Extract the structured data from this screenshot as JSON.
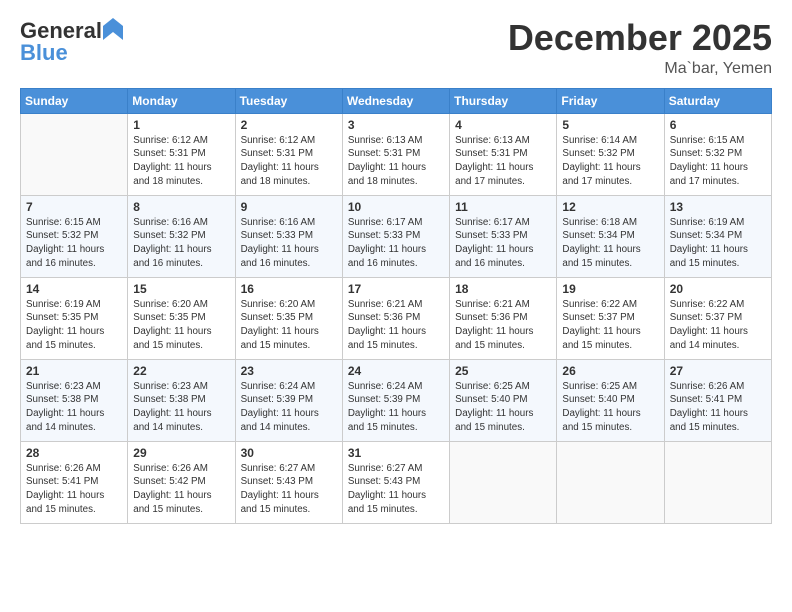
{
  "header": {
    "logo_line1": "General",
    "logo_line2": "Blue",
    "month": "December 2025",
    "location": "Ma`bar, Yemen"
  },
  "days_of_week": [
    "Sunday",
    "Monday",
    "Tuesday",
    "Wednesday",
    "Thursday",
    "Friday",
    "Saturday"
  ],
  "weeks": [
    [
      {
        "day": "",
        "info": ""
      },
      {
        "day": "1",
        "info": "Sunrise: 6:12 AM\nSunset: 5:31 PM\nDaylight: 11 hours\nand 18 minutes."
      },
      {
        "day": "2",
        "info": "Sunrise: 6:12 AM\nSunset: 5:31 PM\nDaylight: 11 hours\nand 18 minutes."
      },
      {
        "day": "3",
        "info": "Sunrise: 6:13 AM\nSunset: 5:31 PM\nDaylight: 11 hours\nand 18 minutes."
      },
      {
        "day": "4",
        "info": "Sunrise: 6:13 AM\nSunset: 5:31 PM\nDaylight: 11 hours\nand 17 minutes."
      },
      {
        "day": "5",
        "info": "Sunrise: 6:14 AM\nSunset: 5:32 PM\nDaylight: 11 hours\nand 17 minutes."
      },
      {
        "day": "6",
        "info": "Sunrise: 6:15 AM\nSunset: 5:32 PM\nDaylight: 11 hours\nand 17 minutes."
      }
    ],
    [
      {
        "day": "7",
        "info": "Sunrise: 6:15 AM\nSunset: 5:32 PM\nDaylight: 11 hours\nand 16 minutes."
      },
      {
        "day": "8",
        "info": "Sunrise: 6:16 AM\nSunset: 5:32 PM\nDaylight: 11 hours\nand 16 minutes."
      },
      {
        "day": "9",
        "info": "Sunrise: 6:16 AM\nSunset: 5:33 PM\nDaylight: 11 hours\nand 16 minutes."
      },
      {
        "day": "10",
        "info": "Sunrise: 6:17 AM\nSunset: 5:33 PM\nDaylight: 11 hours\nand 16 minutes."
      },
      {
        "day": "11",
        "info": "Sunrise: 6:17 AM\nSunset: 5:33 PM\nDaylight: 11 hours\nand 16 minutes."
      },
      {
        "day": "12",
        "info": "Sunrise: 6:18 AM\nSunset: 5:34 PM\nDaylight: 11 hours\nand 15 minutes."
      },
      {
        "day": "13",
        "info": "Sunrise: 6:19 AM\nSunset: 5:34 PM\nDaylight: 11 hours\nand 15 minutes."
      }
    ],
    [
      {
        "day": "14",
        "info": "Sunrise: 6:19 AM\nSunset: 5:35 PM\nDaylight: 11 hours\nand 15 minutes."
      },
      {
        "day": "15",
        "info": "Sunrise: 6:20 AM\nSunset: 5:35 PM\nDaylight: 11 hours\nand 15 minutes."
      },
      {
        "day": "16",
        "info": "Sunrise: 6:20 AM\nSunset: 5:35 PM\nDaylight: 11 hours\nand 15 minutes."
      },
      {
        "day": "17",
        "info": "Sunrise: 6:21 AM\nSunset: 5:36 PM\nDaylight: 11 hours\nand 15 minutes."
      },
      {
        "day": "18",
        "info": "Sunrise: 6:21 AM\nSunset: 5:36 PM\nDaylight: 11 hours\nand 15 minutes."
      },
      {
        "day": "19",
        "info": "Sunrise: 6:22 AM\nSunset: 5:37 PM\nDaylight: 11 hours\nand 15 minutes."
      },
      {
        "day": "20",
        "info": "Sunrise: 6:22 AM\nSunset: 5:37 PM\nDaylight: 11 hours\nand 14 minutes."
      }
    ],
    [
      {
        "day": "21",
        "info": "Sunrise: 6:23 AM\nSunset: 5:38 PM\nDaylight: 11 hours\nand 14 minutes."
      },
      {
        "day": "22",
        "info": "Sunrise: 6:23 AM\nSunset: 5:38 PM\nDaylight: 11 hours\nand 14 minutes."
      },
      {
        "day": "23",
        "info": "Sunrise: 6:24 AM\nSunset: 5:39 PM\nDaylight: 11 hours\nand 14 minutes."
      },
      {
        "day": "24",
        "info": "Sunrise: 6:24 AM\nSunset: 5:39 PM\nDaylight: 11 hours\nand 15 minutes."
      },
      {
        "day": "25",
        "info": "Sunrise: 6:25 AM\nSunset: 5:40 PM\nDaylight: 11 hours\nand 15 minutes."
      },
      {
        "day": "26",
        "info": "Sunrise: 6:25 AM\nSunset: 5:40 PM\nDaylight: 11 hours\nand 15 minutes."
      },
      {
        "day": "27",
        "info": "Sunrise: 6:26 AM\nSunset: 5:41 PM\nDaylight: 11 hours\nand 15 minutes."
      }
    ],
    [
      {
        "day": "28",
        "info": "Sunrise: 6:26 AM\nSunset: 5:41 PM\nDaylight: 11 hours\nand 15 minutes."
      },
      {
        "day": "29",
        "info": "Sunrise: 6:26 AM\nSunset: 5:42 PM\nDaylight: 11 hours\nand 15 minutes."
      },
      {
        "day": "30",
        "info": "Sunrise: 6:27 AM\nSunset: 5:43 PM\nDaylight: 11 hours\nand 15 minutes."
      },
      {
        "day": "31",
        "info": "Sunrise: 6:27 AM\nSunset: 5:43 PM\nDaylight: 11 hours\nand 15 minutes."
      },
      {
        "day": "",
        "info": ""
      },
      {
        "day": "",
        "info": ""
      },
      {
        "day": "",
        "info": ""
      }
    ]
  ]
}
